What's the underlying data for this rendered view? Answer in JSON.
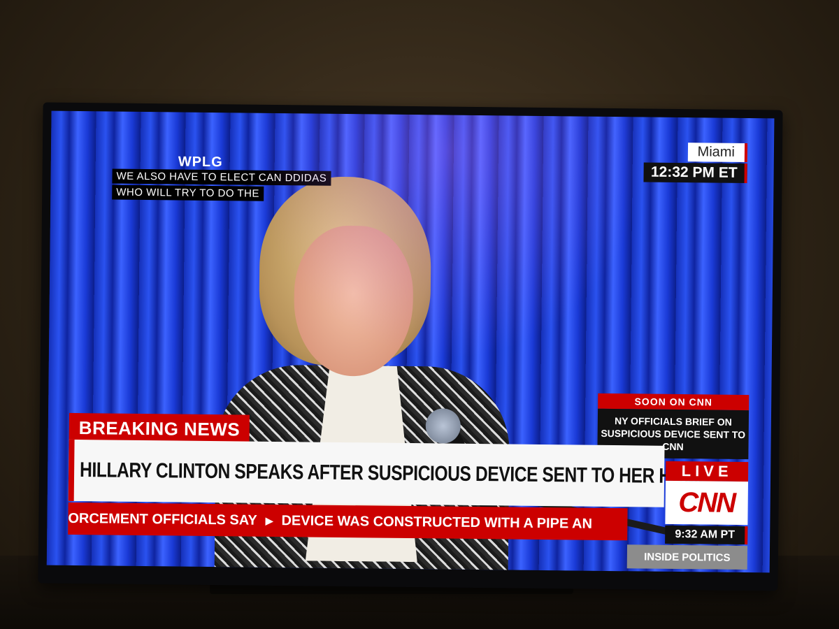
{
  "station": "WPLG",
  "caption": {
    "lines": [
      "WE ALSO HAVE TO ELECT CAN DDIDAS",
      "WHO WILL TRY TO DO THE"
    ]
  },
  "timebox": {
    "city": "Miami",
    "time": "12:32 PM ET"
  },
  "soon": {
    "label": "SOON ON CNN",
    "line1": "NY OFFICIALS BRIEF ON",
    "line2": "SUSPICIOUS DEVICE SENT TO CNN"
  },
  "banner": {
    "breaking": "BREAKING NEWS",
    "headline": "HILLARY CLINTON SPEAKS AFTER SUSPICIOUS DEVICE SENT TO HER HOME"
  },
  "ticker": {
    "item1": "ORCEMENT OFFICIALS SAY",
    "separator": "▶",
    "item2": "DEVICE WAS CONSTRUCTED WITH A PIPE AN"
  },
  "network": {
    "live": "LIVE",
    "logo": "CNN",
    "time": "9:32 AM PT",
    "show": "INSIDE POLITICS"
  },
  "colors": {
    "cnn_red": "#cc0000",
    "curtain_blue": "#2a52f0"
  }
}
